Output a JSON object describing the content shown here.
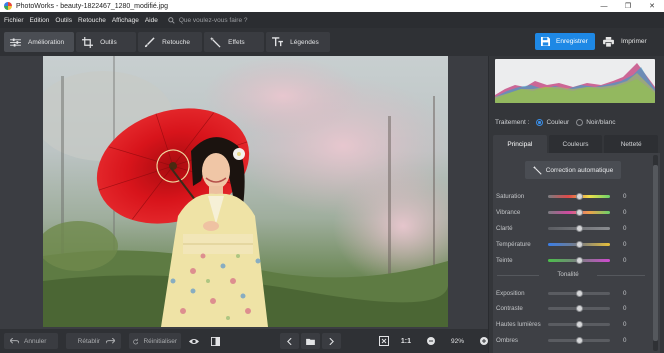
{
  "window": {
    "title": "PhotoWorks - beauty-1822467_1280_modifié.jpg",
    "minimize": "—",
    "restore": "❐",
    "close": "✕"
  },
  "menu": {
    "items": [
      "Fichier",
      "Edition",
      "Outils",
      "Retouche",
      "Affichage",
      "Aide"
    ],
    "search_placeholder": "Que voulez-vous faire ?"
  },
  "toolbar": {
    "tabs": [
      {
        "label": "Amélioration",
        "icon": "sliders-icon",
        "active": true
      },
      {
        "label": "Outils",
        "icon": "crop-icon",
        "active": false
      },
      {
        "label": "Retouche",
        "icon": "brush-icon",
        "active": false
      },
      {
        "label": "Effets",
        "icon": "magic-wand-icon",
        "active": false
      },
      {
        "label": "Légendes",
        "icon": "text-icon",
        "active": false
      }
    ],
    "save_label": "Enregistrer",
    "print_label": "Imprimer"
  },
  "bottombar": {
    "undo_label": "Annuler",
    "redo_label": "Rétablir",
    "reset_label": "Réinitialiser",
    "ratio_label": "1:1",
    "zoom_value": "92%"
  },
  "panel": {
    "treatment_label": "Traitement :",
    "color_label": "Couleur",
    "bw_label": "Noir/blanc",
    "color_selected": true,
    "tabs": [
      {
        "label": "Principal",
        "active": true
      },
      {
        "label": "Couleurs",
        "active": false
      },
      {
        "label": "Netteté",
        "active": false
      }
    ],
    "auto_button_label": "Correction automatique",
    "sliders_top": [
      {
        "label": "Saturation",
        "value": "0",
        "gradient": "#7a7c80,#e04a4a,#f0e04a,#6ad36a"
      },
      {
        "label": "Vibrance",
        "value": "0",
        "gradient": "#7a7c80,#d04aa0,#f0a04a,#6ad36a"
      },
      {
        "label": "Clarté",
        "value": "0",
        "gradient": "#5a5c61,#8a8c90"
      },
      {
        "label": "Température",
        "value": "0",
        "gradient": "#3a7ee8,#7a7c80,#e8c03a"
      },
      {
        "label": "Teinte",
        "value": "0",
        "gradient": "#4ac04a,#7a7c80,#d04ad0"
      }
    ],
    "section_tonalite": "Tonalité",
    "sliders_bottom": [
      {
        "label": "Exposition",
        "value": "0"
      },
      {
        "label": "Contraste",
        "value": "0"
      },
      {
        "label": "Hautes lumières",
        "value": "0"
      },
      {
        "label": "Ombres",
        "value": "0"
      }
    ]
  },
  "colors": {
    "accent": "#1e88e5",
    "umbrella": "#d8141b",
    "kimono": "#efe3a6"
  }
}
